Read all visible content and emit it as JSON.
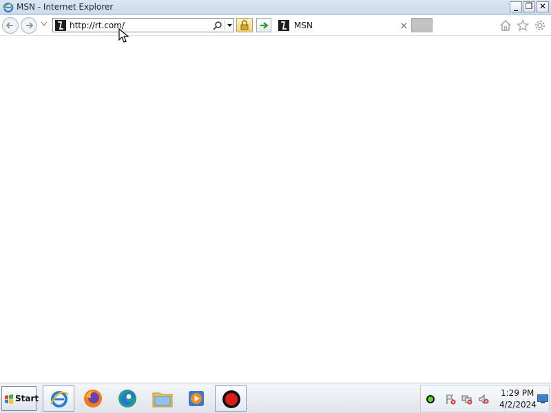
{
  "window": {
    "title": "MSN - Internet Explorer",
    "controls": {
      "minimize": "_",
      "maximize": "❐",
      "close": "✕"
    }
  },
  "navbar": {
    "address_url": "http://rt.com/",
    "tab_title": "MSN",
    "tab_close": "×"
  },
  "icons": {
    "browser": "ie-logo-icon",
    "back": "back-arrow-icon",
    "forward": "forward-arrow-icon",
    "search": "magnifier-icon",
    "lock": "padlock-icon",
    "go": "green-arrow-icon",
    "home": "home-icon",
    "favorites": "star-icon",
    "tools": "gear-icon"
  },
  "taskbar": {
    "start_label": "Start",
    "apps": [
      "Internet Explorer",
      "Firefox",
      "Edge",
      "File Explorer",
      "Media Player",
      "Recorder"
    ],
    "clock_time": "1:29 PM",
    "clock_date": "4/2/2024"
  },
  "colors": {
    "titlebar": "#c9d9ee",
    "lock_button": "#f0d27a",
    "go_arrow": "#2e9b2e",
    "new_tab": "#c2c2c2"
  }
}
